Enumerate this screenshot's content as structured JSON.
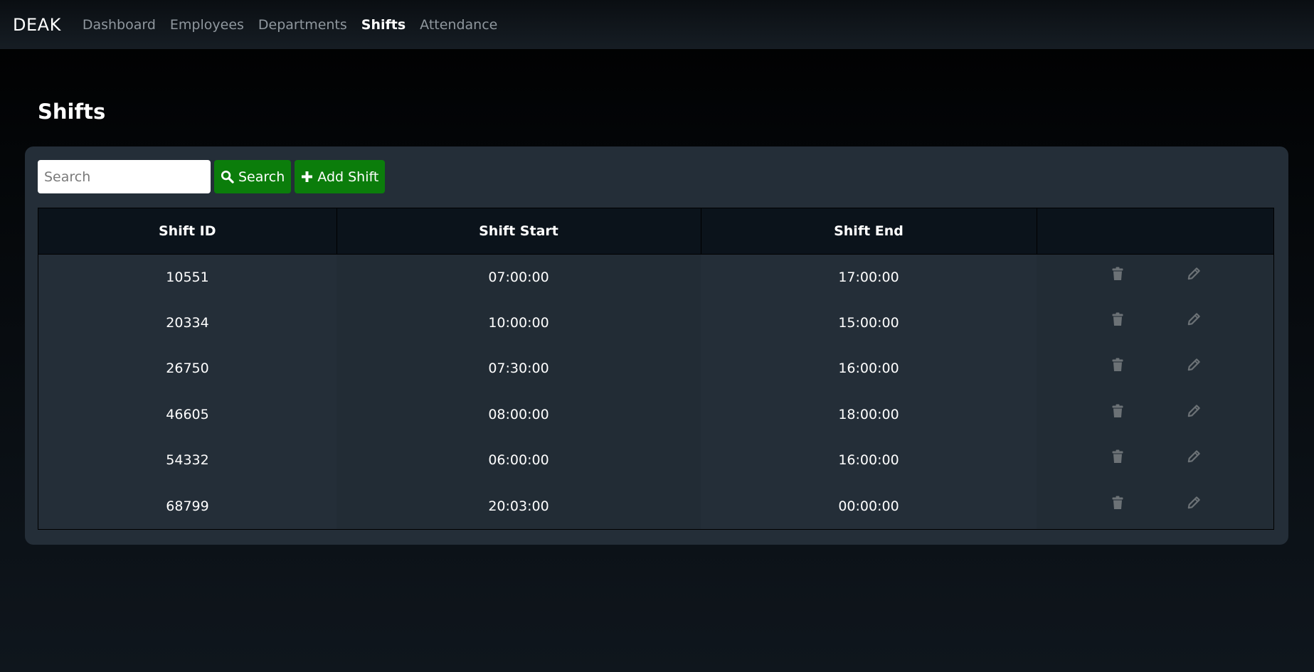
{
  "nav": {
    "brand": "DEAK",
    "links": [
      {
        "label": "Dashboard",
        "active": false
      },
      {
        "label": "Employees",
        "active": false
      },
      {
        "label": "Departments",
        "active": false
      },
      {
        "label": "Shifts",
        "active": true
      },
      {
        "label": "Attendance",
        "active": false
      }
    ]
  },
  "page": {
    "title": "Shifts"
  },
  "toolbar": {
    "search_placeholder": "Search",
    "search_value": "",
    "search_label": "Search",
    "search_icon": "search-icon",
    "add_label": "Add Shift",
    "add_icon": "plus-icon"
  },
  "table": {
    "columns": [
      "Shift ID",
      "Shift Start",
      "Shift End",
      ""
    ],
    "rows": [
      {
        "id": "10551",
        "start": "07:00:00",
        "end": "17:00:00"
      },
      {
        "id": "20334",
        "start": "10:00:00",
        "end": "15:00:00"
      },
      {
        "id": "26750",
        "start": "07:30:00",
        "end": "16:00:00"
      },
      {
        "id": "46605",
        "start": "08:00:00",
        "end": "18:00:00"
      },
      {
        "id": "54332",
        "start": "06:00:00",
        "end": "16:00:00"
      },
      {
        "id": "68799",
        "start": "20:03:00",
        "end": "00:00:00"
      }
    ],
    "row_actions": [
      "trash-icon",
      "pencil-icon"
    ]
  },
  "colors": {
    "accent_green": "#0b7d0b",
    "panel": "#242e38",
    "header_bg": "#0b131b",
    "icon_gray": "#6c7276"
  }
}
